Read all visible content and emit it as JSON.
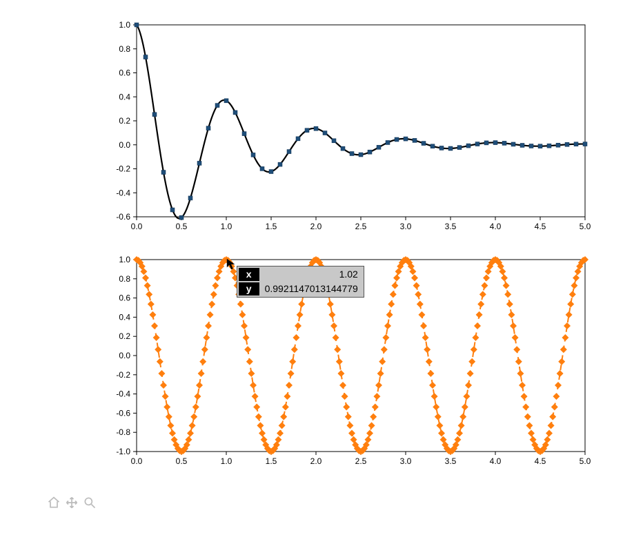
{
  "chart_data": [
    {
      "type": "line",
      "title": "",
      "xlabel": "",
      "ylabel": "",
      "xlim": [
        0,
        5
      ],
      "ylim": [
        -0.6,
        1.0
      ],
      "xticks": [
        0.0,
        0.5,
        1.0,
        1.5,
        2.0,
        2.5,
        3.0,
        3.5,
        4.0,
        4.5,
        5.0
      ],
      "yticks": [
        -0.6,
        -0.4,
        -0.2,
        0.0,
        0.2,
        0.4,
        0.6,
        0.8,
        1.0
      ],
      "function": "exp(-x) * cos(2*pi*x)",
      "marker_dx": 0.1,
      "series": [
        {
          "name": "damped-cos-line",
          "color": "#000000",
          "style": "solid",
          "width": 2.2
        },
        {
          "name": "damped-cos-markers",
          "color": "#1f4e79",
          "style": "markers",
          "marker": "square",
          "size": 6
        }
      ]
    },
    {
      "type": "line",
      "title": "",
      "xlabel": "",
      "ylabel": "",
      "xlim": [
        0,
        5
      ],
      "ylim": [
        -1.0,
        1.0
      ],
      "xticks": [
        0.0,
        0.5,
        1.0,
        1.5,
        2.0,
        2.5,
        3.0,
        3.5,
        4.0,
        4.5,
        5.0
      ],
      "yticks": [
        -1.0,
        -0.8,
        -0.6,
        -0.4,
        -0.2,
        0.0,
        0.2,
        0.4,
        0.6,
        0.8,
        1.0
      ],
      "function": "cos(2*pi*x)",
      "marker_dx": 0.02,
      "series": [
        {
          "name": "cos-dashed",
          "color": "#ff7f0e",
          "style": "dashed",
          "width": 2.0,
          "marker": "diamond",
          "size": 5
        }
      ],
      "hover": {
        "x_label": "x",
        "y_label": "y",
        "x": "1.02",
        "y": "0.9921147013144779"
      }
    }
  ],
  "toolbar": {
    "home_label": "Home",
    "pan_label": "Pan",
    "zoom_label": "Zoom"
  }
}
